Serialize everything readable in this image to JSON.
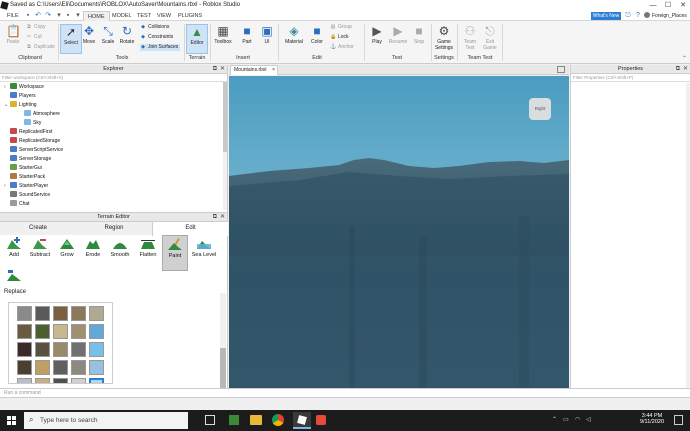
{
  "window": {
    "title": "Saved as C:\\Users\\Eli\\Documents\\ROBLOX\\AutoSaver\\Mountains.rbxl - Roblox Studio",
    "min_glyph": "—",
    "max_glyph": "☐",
    "close_glyph": "✕"
  },
  "menu": {
    "file": "FILE",
    "home": "HOME",
    "model": "MODEL",
    "test": "TEST",
    "view": "VIEW",
    "plugins": "PLUGINS",
    "whats_new": "What's New",
    "username": "Foreign_Places"
  },
  "ribbon": {
    "clipboard": {
      "paste": "Paste",
      "copy": "Copy",
      "cut": "Cut",
      "duplicate": "Duplicate",
      "group_label": "Clipboard"
    },
    "tools": {
      "select": "Select",
      "move": "Move",
      "scale": "Scale",
      "rotate": "Rotate",
      "collisions": "Collisions",
      "constraints": "Constraints",
      "join_surfaces": "Join Surfaces",
      "group_label": "Tools"
    },
    "terrain": {
      "editor": "Editor",
      "group_label": "Terrain"
    },
    "insert": {
      "toolbox": "Toolbox",
      "part": "Part",
      "ui": "UI",
      "group_label": "Insert"
    },
    "edit": {
      "material": "Material",
      "color": "Color",
      "group": "Group",
      "lock": "Lock",
      "anchor": "Anchor",
      "group_label": "Edit"
    },
    "test": {
      "play": "Play",
      "resume": "Resume",
      "stop": "Stop",
      "group_label": "Test"
    },
    "settings": {
      "game_settings_1": "Game",
      "game_settings_2": "Settings",
      "group_label": "Settings"
    },
    "team_test": {
      "team_test_1": "Team",
      "team_test_2": "Test",
      "exit_game_1": "Exit",
      "exit_game_2": "Game",
      "group_label": "Team Test"
    }
  },
  "explorer": {
    "title": "Explorer",
    "filter_placeholder": "Filter workspace (Ctrl+Shift+X)",
    "items": [
      {
        "label": "Workspace",
        "arrow": "›",
        "color": "#3b8a3b"
      },
      {
        "label": "Players",
        "arrow": "",
        "color": "#4a7cc7"
      },
      {
        "label": "Lighting",
        "arrow": "⌄",
        "color": "#e0b030"
      },
      {
        "label": "Atmosphere",
        "arrow": "",
        "color": "#7fb7e6"
      },
      {
        "label": "Sky",
        "arrow": "",
        "color": "#7fb7e6"
      },
      {
        "label": "ReplicatedFirst",
        "arrow": "",
        "color": "#c74a4a"
      },
      {
        "label": "ReplicatedStorage",
        "arrow": "",
        "color": "#c74a4a"
      },
      {
        "label": "ServerScriptService",
        "arrow": "",
        "color": "#4a7cc7"
      },
      {
        "label": "ServerStorage",
        "arrow": "",
        "color": "#4a7cc7"
      },
      {
        "label": "StarterGui",
        "arrow": "",
        "color": "#6a9f4a"
      },
      {
        "label": "StarterPack",
        "arrow": "",
        "color": "#b07a40"
      },
      {
        "label": "StarterPlayer",
        "arrow": "›",
        "color": "#4a7cc7"
      },
      {
        "label": "SoundService",
        "arrow": "",
        "color": "#7a7a7a"
      },
      {
        "label": "Chat",
        "arrow": "",
        "color": "#9a9a9a"
      }
    ]
  },
  "terrain_editor": {
    "title": "Terrain Editor",
    "tabs": {
      "create": "Create",
      "region": "Region",
      "edit": "Edit"
    },
    "tools": {
      "add": "Add",
      "subtract": "Subtract",
      "grow": "Grow",
      "erode": "Erode",
      "smooth": "Smooth",
      "flatten": "Flatten",
      "paint": "Paint",
      "sea_level": "Sea Level",
      "replace": "Replace"
    },
    "replace_heading": "Replace",
    "materials": [
      "#8a8a8a",
      "#5a5a5a",
      "#7a6040",
      "#8b7a5a",
      "#b0a890",
      "#6a5a40",
      "#4a6030",
      "#c8b890",
      "#a09070",
      "#62a8d8",
      "#3a2a2a",
      "#5a5040",
      "#9a8a6a",
      "#707070",
      "#78c0e8",
      "#4a4030",
      "#c0a060",
      "#606060",
      "#8a8a80",
      "#9ac0e0",
      "#b8c0c8",
      "#c8b080",
      "#505050",
      "#d0d0d0",
      "#b0d8f0",
      "#a8c8e8",
      "#d0b070"
    ]
  },
  "viewport": {
    "tab_label": "Mountains.rbxl",
    "tab_close": "×",
    "compass": "Right"
  },
  "properties": {
    "title": "Properties",
    "filter_placeholder": "Filter Properties (Ctrl+Shift+P)"
  },
  "command_bar": {
    "placeholder": "Run a command"
  },
  "taskbar": {
    "search_placeholder": "Type here to search",
    "time": "3:44 PM",
    "date": "9/11/2020"
  }
}
